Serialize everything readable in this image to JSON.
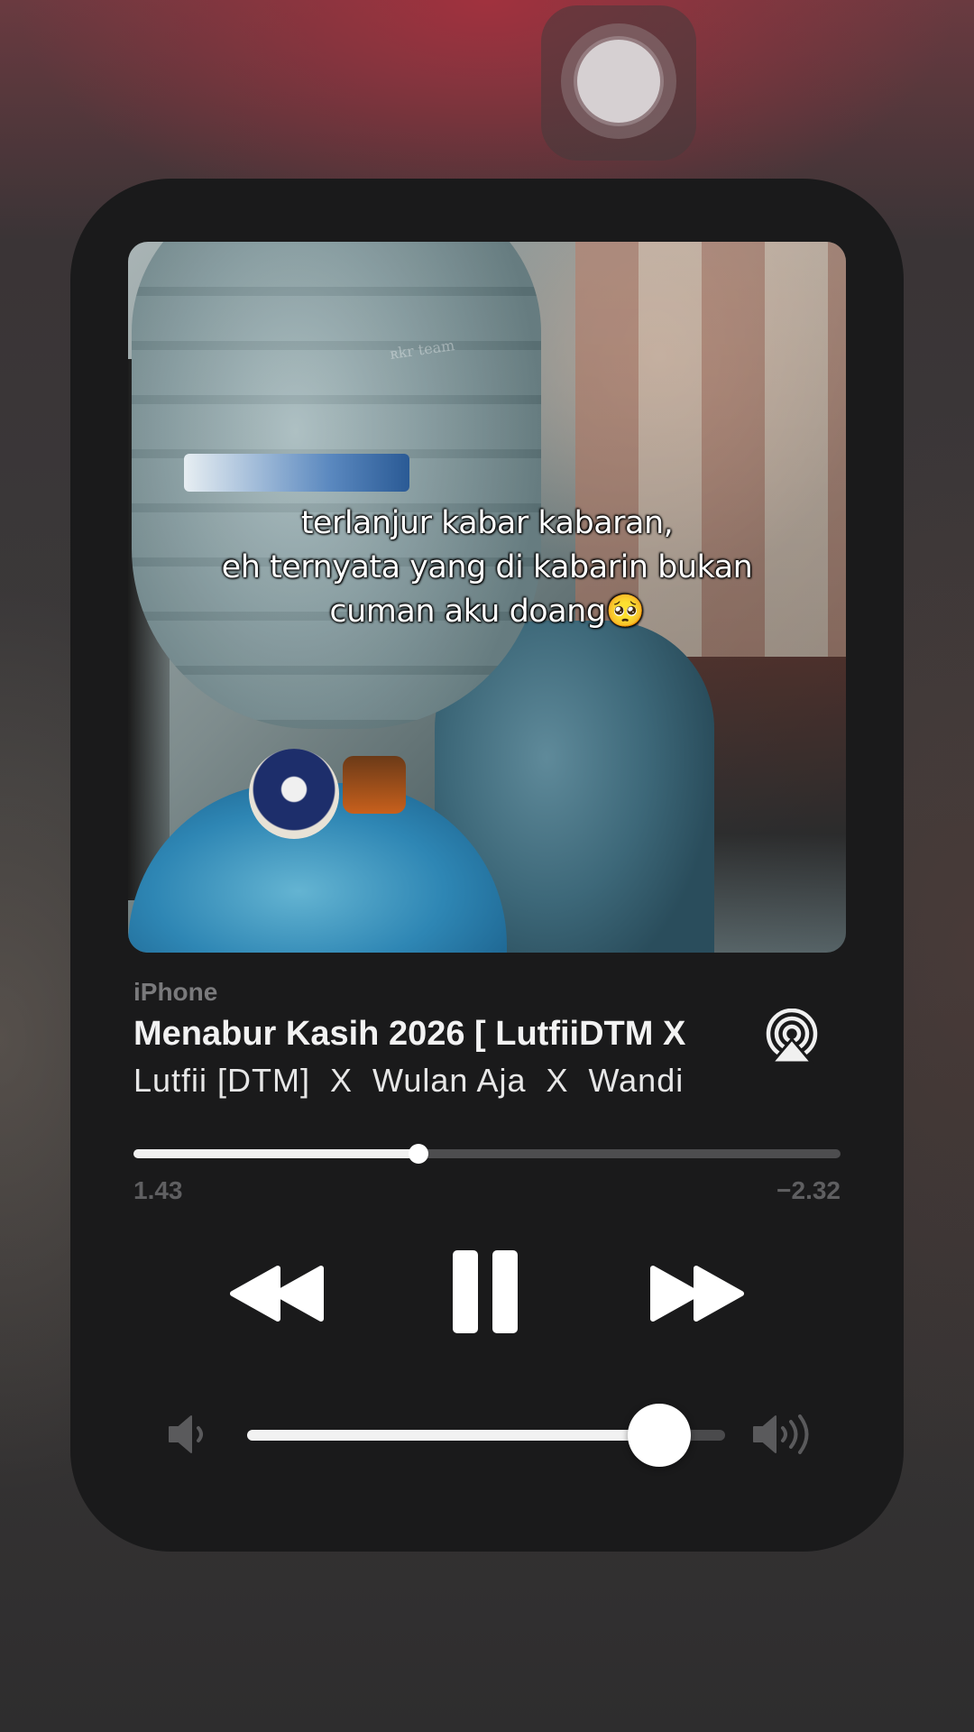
{
  "now_playing": {
    "source": "iPhone",
    "title": "Menabur Kasih 2026 [ LutfiiDTM X",
    "artist": "Lutfii [DTM]  X  Wulan Aja  X  Wandi",
    "artwork_caption": "terlanjur kabar kabaran,\neh ternyata yang di kabarin bukan\ncuman aku doang🥺",
    "artwork_watermark": "ʀkr team"
  },
  "progress": {
    "elapsed": "1.43",
    "remaining": "−2.32",
    "fraction": 0.403
  },
  "volume": {
    "fraction": 0.863
  },
  "icons": {
    "top": "toggle-knob-icon",
    "output": "airplay-icon",
    "rewind": "rewind-icon",
    "play_pause": "pause-icon",
    "forward": "fast-forward-icon",
    "volume_low": "speaker-low-icon",
    "volume_high": "speaker-high-icon"
  },
  "colors": {
    "card_background": "#1a1a1b",
    "accent": "#ffffff",
    "muted_text": "#7a7a7c"
  }
}
